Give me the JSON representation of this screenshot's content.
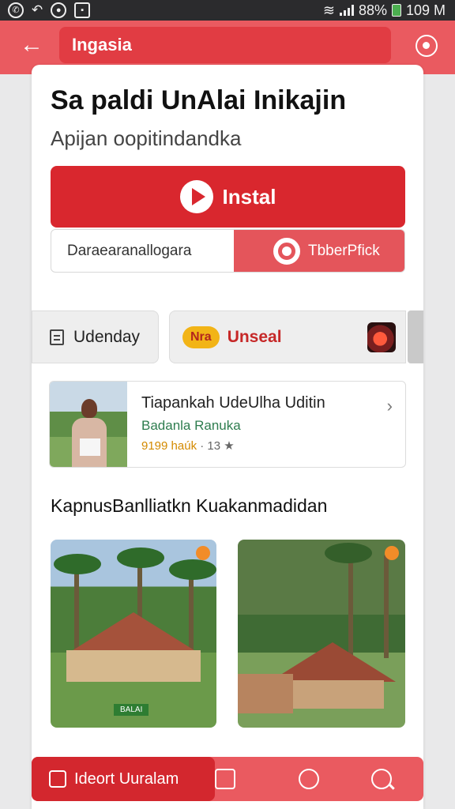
{
  "status_bar": {
    "left_icons": [
      "whatsapp-icon",
      "back-arrow-icon",
      "record-icon",
      "photo-icon"
    ],
    "battery": "88%",
    "time": "109 M"
  },
  "app_bar": {
    "title": "Ingasia"
  },
  "header": {
    "title": "Sa paldi UnAlai Inikajin",
    "subtitle": "Apijan oopitindandka"
  },
  "install_button": {
    "label": "Instal"
  },
  "split_row": {
    "left_text": "Daraearanallogara",
    "right_text": "TbberPfick"
  },
  "chips": {
    "left_label": "Udenday",
    "pill_text": "Nra",
    "right_label": "Unseal"
  },
  "place_card": {
    "title": "Tiapankah UdeUlha Uditin",
    "subtitle": "Badanla Ranuka",
    "rating": "9199 haúk",
    "meta": "· 13",
    "star": "★"
  },
  "section_title": "KapnusBanlliatkn Kuakanmadidan",
  "photo_badge": "BALAI",
  "bottom_nav": {
    "active_label": "Ideort Uuralam"
  },
  "colors": {
    "primary": "#d9272e",
    "appbar": "#ea5a60",
    "accent": "#f2b417"
  }
}
